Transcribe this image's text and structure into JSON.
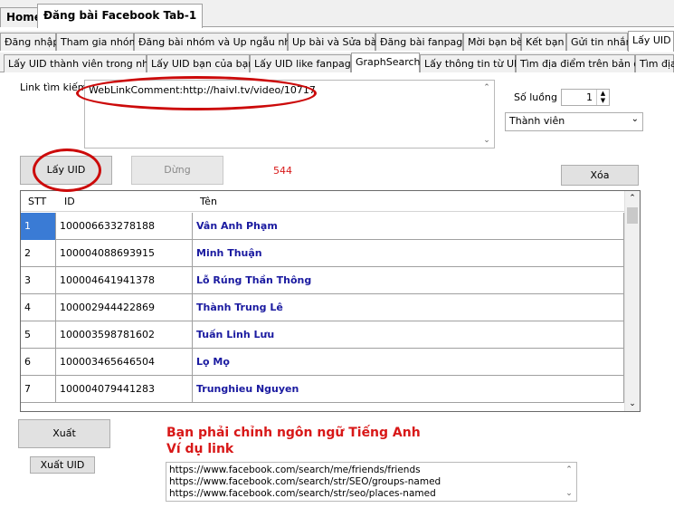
{
  "top_tabs": [
    {
      "label": "Home"
    },
    {
      "label": "Đăng bài Facebook Tab-1"
    }
  ],
  "row2_tabs": [
    {
      "label": "Đăng nhập"
    },
    {
      "label": "Tham gia nhóm"
    },
    {
      "label": "Đăng bài nhóm và Up ngẫu nhiên"
    },
    {
      "label": "Up bài và Sửa bài"
    },
    {
      "label": "Đăng bài fanpage"
    },
    {
      "label": "Mời bạn bè"
    },
    {
      "label": "Kết bạn"
    },
    {
      "label": "Gửi tin nhắn"
    },
    {
      "label": "Lấy UID"
    }
  ],
  "row3_tabs": [
    {
      "label": "Lấy UID thành viên trong nhóm"
    },
    {
      "label": "Lấy UID bạn của bạn"
    },
    {
      "label": "Lấy UID like fanpage"
    },
    {
      "label": "GraphSearch"
    },
    {
      "label": "Lấy thông tin từ UID"
    },
    {
      "label": "Tìm địa điểm trên bản đồ"
    },
    {
      "label": "Tìm địa"
    }
  ],
  "search": {
    "label": "Link tìm kiếm",
    "value": "WebLinkComment:http://haivl.tv/video/10717"
  },
  "thread": {
    "label": "Số luồng",
    "value": "1"
  },
  "member_select": {
    "value": "Thành viên"
  },
  "buttons": {
    "get_uid": "Lấy UID",
    "stop": "Dừng",
    "delete": "Xóa",
    "export": "Xuất",
    "export_uid": "Xuất UID"
  },
  "count": "544",
  "table": {
    "headers": [
      "STT",
      "ID",
      "Tên"
    ],
    "rows": [
      {
        "stt": "1",
        "id": "100006633278188",
        "name": "Vân Anh Phạm"
      },
      {
        "stt": "2",
        "id": "100004088693915",
        "name": "Minh Thuận"
      },
      {
        "stt": "3",
        "id": "100004641941378",
        "name": "Lỗ Rúng Thần Thông"
      },
      {
        "stt": "4",
        "id": "100002944422869",
        "name": "Thành Trung Lê"
      },
      {
        "stt": "5",
        "id": "100003598781602",
        "name": "Tuấn Linh Lưu"
      },
      {
        "stt": "6",
        "id": "100003465646504",
        "name": "Lọ Mọ"
      },
      {
        "stt": "7",
        "id": "100004079441283",
        "name": "Trunghieu Nguyen"
      }
    ]
  },
  "notice": {
    "line1": "Bạn phải chỉnh ngôn ngữ Tiếng Anh",
    "line2": "Ví dụ link"
  },
  "examples": [
    "https://www.facebook.com/search/me/friends/friends",
    "https://www.facebook.com/search/str/SEO/groups-named",
    "https://www.facebook.com/search/str/seo/places-named"
  ]
}
